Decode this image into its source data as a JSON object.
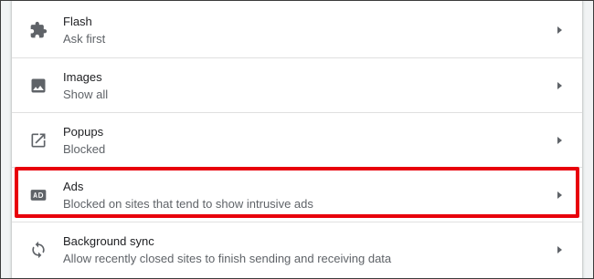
{
  "settings": {
    "items": [
      {
        "title": "Flash",
        "subtitle": "Ask first",
        "icon": "puzzle-icon"
      },
      {
        "title": "Images",
        "subtitle": "Show all",
        "icon": "image-icon"
      },
      {
        "title": "Popups",
        "subtitle": "Blocked",
        "icon": "open-in-new-icon"
      },
      {
        "title": "Ads",
        "subtitle": "Blocked on sites that tend to show intrusive ads",
        "icon": "ad-icon"
      },
      {
        "title": "Background sync",
        "subtitle": "Allow recently closed sites to finish sending and receiving data",
        "icon": "sync-icon"
      }
    ]
  },
  "highlight": {
    "target": "Ads",
    "color": "#e8000b"
  },
  "colors": {
    "icon": "#5f6368",
    "title": "#202124",
    "subtitle": "#5f6368",
    "background": "#f1f3f4"
  }
}
